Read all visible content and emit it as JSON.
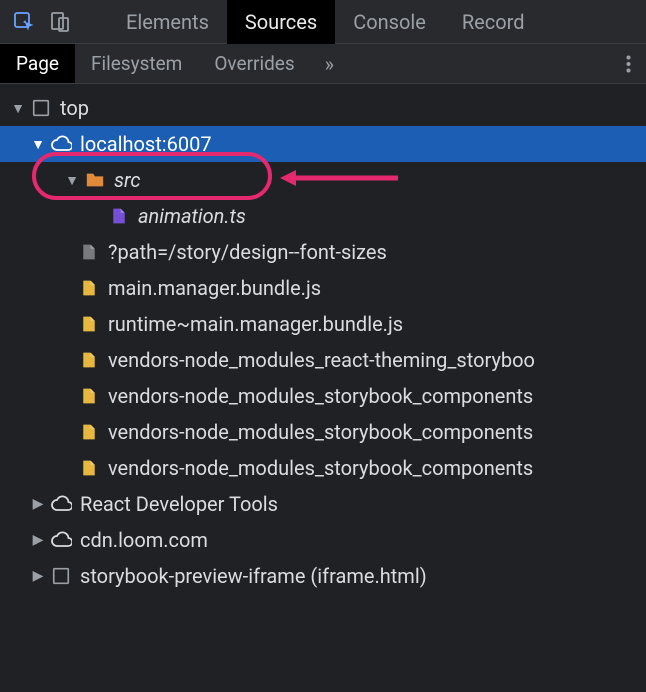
{
  "topTabs": {
    "elements": "Elements",
    "sources": "Sources",
    "console": "Console",
    "recorder": "Record"
  },
  "subTabs": {
    "page": "Page",
    "filesystem": "Filesystem",
    "overrides": "Overrides"
  },
  "tree": {
    "top": "top",
    "localhost": "localhost:6007",
    "src": "src",
    "animation": "animation.ts",
    "pathfile": "?path=/story/design--font-sizes",
    "mainmgr": "main.manager.bundle.js",
    "runtime": "runtime~main.manager.bundle.js",
    "vendors1": "vendors-node_modules_react-theming_storyboo",
    "vendors2": "vendors-node_modules_storybook_components",
    "vendors3": "vendors-node_modules_storybook_components",
    "vendors4": "vendors-node_modules_storybook_components",
    "reactdev": "React Developer Tools",
    "loom": "cdn.loom.com",
    "iframe": "storybook-preview-iframe (iframe.html)"
  }
}
